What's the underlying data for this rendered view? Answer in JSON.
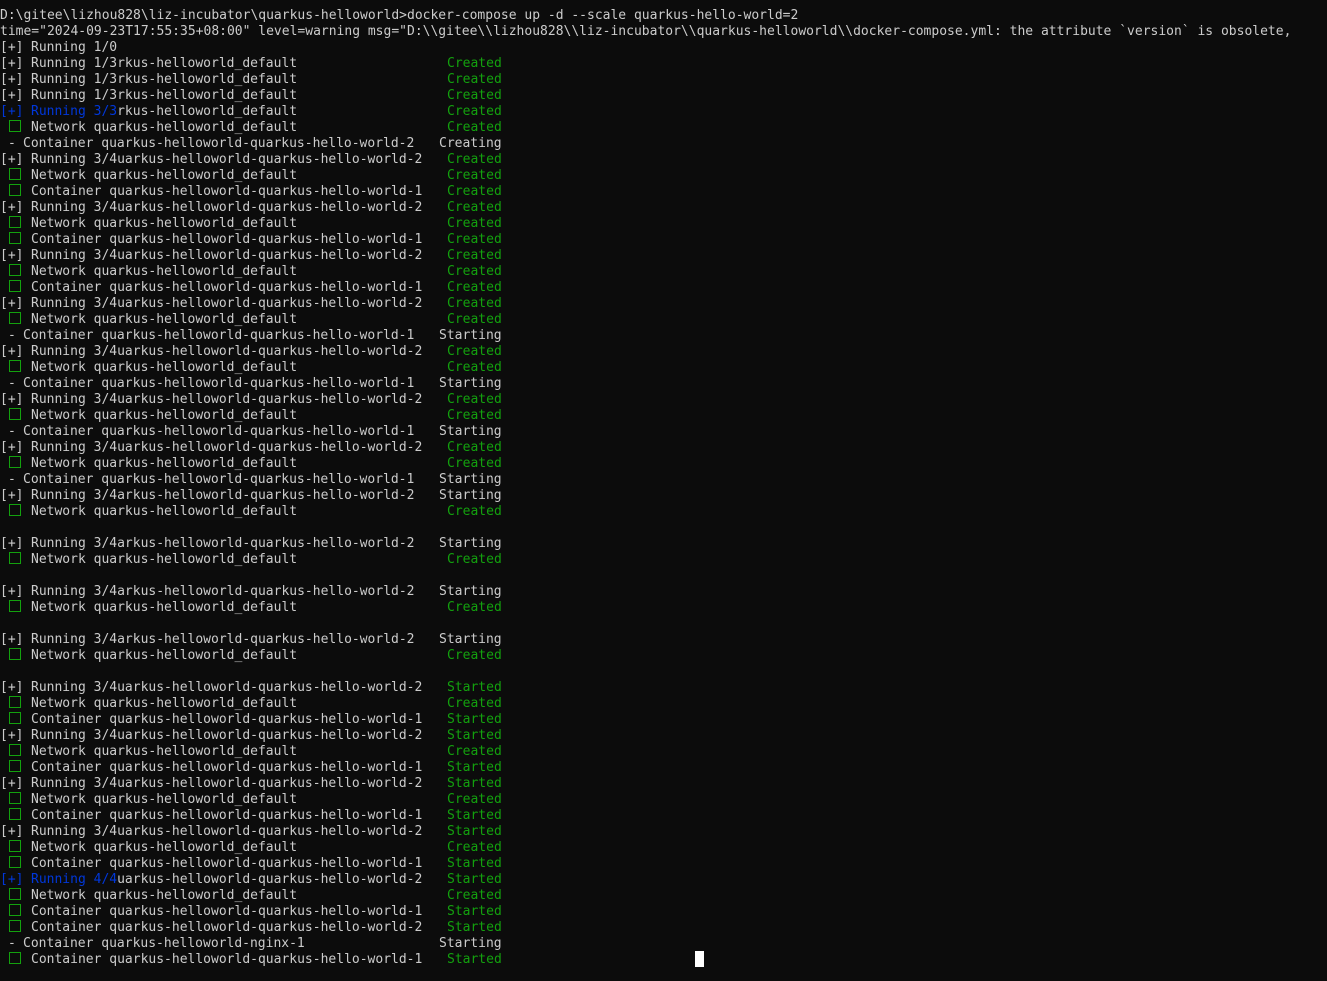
{
  "header": {
    "command": "D:\\gitee\\lizhou828\\liz-incubator\\quarkus-helloworld>docker-compose up -d --scale quarkus-hello-world=2",
    "warning": "time=\"2024-09-23T17:55:35+08:00\" level=warning msg=\"D:\\\\gitee\\\\lizhou828\\\\liz-incubator\\\\quarkus-helloworld\\\\docker-compose.yml: the attribute `version` is obsolete,"
  },
  "colors": {
    "background": "#0c0c0c",
    "text": "#cccccc",
    "status_green": "#13a10e",
    "highlight_blue": "#0037da"
  },
  "icons": {
    "check": "green-square-icon",
    "running": "plus-bracket-icon",
    "pending": "dash-icon"
  },
  "lines": [
    {
      "t": "running",
      "p": "[+]",
      "txt": "Running 1/0",
      "s": ""
    },
    {
      "t": "running",
      "p": "[+]",
      "txt": "Running 1/3rkus-helloworld_default",
      "s": "Created"
    },
    {
      "t": "running",
      "p": "[+]",
      "txt": "Running 1/3rkus-helloworld_default",
      "s": "Created"
    },
    {
      "t": "running",
      "p": "[+]",
      "txt": "Running 1/3rkus-helloworld_default",
      "s": "Created"
    },
    {
      "t": "running-blue",
      "p": "[+]",
      "txt": "Running 3/3",
      "rest": "rkus-helloworld_default",
      "s": "Created"
    },
    {
      "t": "check",
      "txt": "Network quarkus-helloworld_default",
      "s": "Created"
    },
    {
      "t": "dash",
      "p": "-",
      "txt": "Container quarkus-helloworld-quarkus-hello-world-2",
      "s": "Creating",
      "wide": true
    },
    {
      "t": "running",
      "p": "[+]",
      "txt": "Running 3/4uarkus-helloworld-quarkus-hello-world-2",
      "s": "Created"
    },
    {
      "t": "check",
      "txt": "Network quarkus-helloworld_default",
      "s": "Created"
    },
    {
      "t": "check",
      "txt": "Container quarkus-helloworld-quarkus-hello-world-1",
      "s": "Created"
    },
    {
      "t": "running",
      "p": "[+]",
      "txt": "Running 3/4uarkus-helloworld-quarkus-hello-world-2",
      "s": "Created"
    },
    {
      "t": "check",
      "txt": "Network quarkus-helloworld_default",
      "s": "Created"
    },
    {
      "t": "check",
      "txt": "Container quarkus-helloworld-quarkus-hello-world-1",
      "s": "Created"
    },
    {
      "t": "running",
      "p": "[+]",
      "txt": "Running 3/4uarkus-helloworld-quarkus-hello-world-2",
      "s": "Created"
    },
    {
      "t": "check",
      "txt": "Network quarkus-helloworld_default",
      "s": "Created"
    },
    {
      "t": "check",
      "txt": "Container quarkus-helloworld-quarkus-hello-world-1",
      "s": "Created"
    },
    {
      "t": "running",
      "p": "[+]",
      "txt": "Running 3/4uarkus-helloworld-quarkus-hello-world-2",
      "s": "Created"
    },
    {
      "t": "check",
      "txt": "Network quarkus-helloworld_default",
      "s": "Created"
    },
    {
      "t": "dash",
      "p": "-",
      "txt": "Container quarkus-helloworld-quarkus-hello-world-1",
      "s": "Starting",
      "wide": true
    },
    {
      "t": "running",
      "p": "[+]",
      "txt": "Running 3/4uarkus-helloworld-quarkus-hello-world-2",
      "s": "Created"
    },
    {
      "t": "check",
      "txt": "Network quarkus-helloworld_default",
      "s": "Created"
    },
    {
      "t": "dash",
      "p": "-",
      "txt": "Container quarkus-helloworld-quarkus-hello-world-1",
      "s": "Starting",
      "wide": true
    },
    {
      "t": "running",
      "p": "[+]",
      "txt": "Running 3/4uarkus-helloworld-quarkus-hello-world-2",
      "s": "Created"
    },
    {
      "t": "check",
      "txt": "Network quarkus-helloworld_default",
      "s": "Created"
    },
    {
      "t": "dash",
      "p": "-",
      "txt": "Container quarkus-helloworld-quarkus-hello-world-1",
      "s": "Starting",
      "wide": true
    },
    {
      "t": "running",
      "p": "[+]",
      "txt": "Running 3/4uarkus-helloworld-quarkus-hello-world-2",
      "s": "Created"
    },
    {
      "t": "check",
      "txt": "Network quarkus-helloworld_default",
      "s": "Created"
    },
    {
      "t": "dash",
      "p": "-",
      "txt": "Container quarkus-helloworld-quarkus-hello-world-1",
      "s": "Starting",
      "wide": true
    },
    {
      "t": "running",
      "p": "[+]",
      "txt": "Running 3/4arkus-helloworld-quarkus-hello-world-2",
      "s": "Starting",
      "wide": true
    },
    {
      "t": "check",
      "txt": "Network quarkus-helloworld_default",
      "s": "Created"
    },
    {
      "t": "blank"
    },
    {
      "t": "running",
      "p": "[+]",
      "txt": "Running 3/4arkus-helloworld-quarkus-hello-world-2",
      "s": "Starting",
      "wide": true
    },
    {
      "t": "check",
      "txt": "Network quarkus-helloworld_default",
      "s": "Created"
    },
    {
      "t": "blank"
    },
    {
      "t": "running",
      "p": "[+]",
      "txt": "Running 3/4arkus-helloworld-quarkus-hello-world-2",
      "s": "Starting",
      "wide": true
    },
    {
      "t": "check",
      "txt": "Network quarkus-helloworld_default",
      "s": "Created"
    },
    {
      "t": "blank"
    },
    {
      "t": "running",
      "p": "[+]",
      "txt": "Running 3/4arkus-helloworld-quarkus-hello-world-2",
      "s": "Starting",
      "wide": true
    },
    {
      "t": "check",
      "txt": "Network quarkus-helloworld_default",
      "s": "Created"
    },
    {
      "t": "blank"
    },
    {
      "t": "running",
      "p": "[+]",
      "txt": "Running 3/4uarkus-helloworld-quarkus-hello-world-2",
      "s": "Started"
    },
    {
      "t": "check",
      "txt": "Network quarkus-helloworld_default",
      "s": "Created"
    },
    {
      "t": "check",
      "txt": "Container quarkus-helloworld-quarkus-hello-world-1",
      "s": "Started"
    },
    {
      "t": "running",
      "p": "[+]",
      "txt": "Running 3/4uarkus-helloworld-quarkus-hello-world-2",
      "s": "Started"
    },
    {
      "t": "check",
      "txt": "Network quarkus-helloworld_default",
      "s": "Created"
    },
    {
      "t": "check",
      "txt": "Container quarkus-helloworld-quarkus-hello-world-1",
      "s": "Started"
    },
    {
      "t": "running",
      "p": "[+]",
      "txt": "Running 3/4uarkus-helloworld-quarkus-hello-world-2",
      "s": "Started"
    },
    {
      "t": "check",
      "txt": "Network quarkus-helloworld_default",
      "s": "Created"
    },
    {
      "t": "check",
      "txt": "Container quarkus-helloworld-quarkus-hello-world-1",
      "s": "Started"
    },
    {
      "t": "running",
      "p": "[+]",
      "txt": "Running 3/4uarkus-helloworld-quarkus-hello-world-2",
      "s": "Started"
    },
    {
      "t": "check",
      "txt": "Network quarkus-helloworld_default",
      "s": "Created"
    },
    {
      "t": "check",
      "txt": "Container quarkus-helloworld-quarkus-hello-world-1",
      "s": "Started"
    },
    {
      "t": "running-blue",
      "p": "[+]",
      "txt": "Running 4/4",
      "rest": "uarkus-helloworld-quarkus-hello-world-2",
      "s": "Started"
    },
    {
      "t": "check",
      "txt": "Network quarkus-helloworld_default",
      "s": "Created"
    },
    {
      "t": "check",
      "txt": "Container quarkus-helloworld-quarkus-hello-world-1",
      "s": "Started"
    },
    {
      "t": "check",
      "txt": "Container quarkus-helloworld-quarkus-hello-world-2",
      "s": "Started"
    },
    {
      "t": "dash",
      "p": "-",
      "txt": "Container quarkus-helloworld-nginx-1",
      "s": "Starting",
      "wide": true
    },
    {
      "t": "check",
      "txt": "Container quarkus-helloworld-quarkus-hello-world-1",
      "s": "Started"
    }
  ]
}
